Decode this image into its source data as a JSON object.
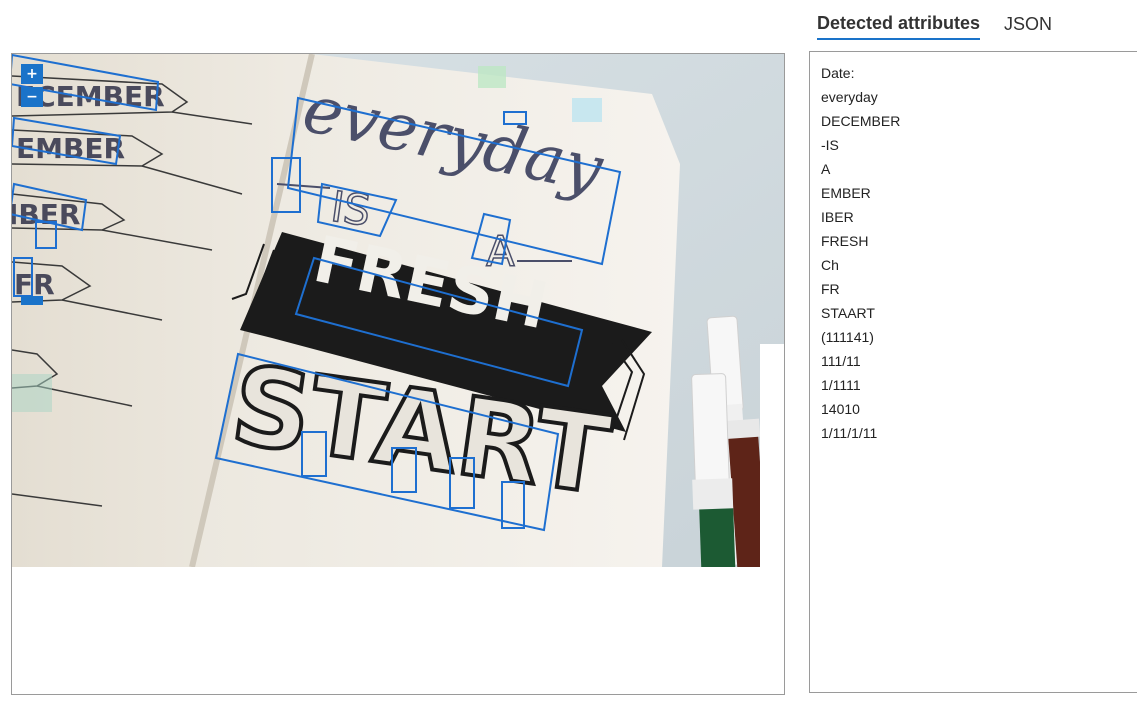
{
  "tabs": [
    {
      "label": "Detected attributes",
      "active": true
    },
    {
      "label": "JSON",
      "active": false
    }
  ],
  "viewer": {
    "zoom_in_icon": "plus-icon",
    "zoom_out_icon": "minus-icon",
    "photo_text": {
      "line1": "everyday",
      "is": "IS",
      "a": "A",
      "fresh": "FRESH",
      "start": "START",
      "months": [
        "ECEMBER",
        "EMBER",
        "IBER",
        "FR"
      ]
    }
  },
  "attributes": [
    "Date:",
    "everyday",
    "DECEMBER",
    "-IS",
    "A",
    "EMBER",
    "IBER",
    "FRESH",
    "Ch",
    "FR",
    "STAART",
    "(111141)",
    "111/11",
    "1/1111",
    "14010",
    "1/11/1/11"
  ],
  "colors": {
    "accent": "#1a73c9",
    "box": "#1e6fd0",
    "banner": "#1b1b1b"
  }
}
